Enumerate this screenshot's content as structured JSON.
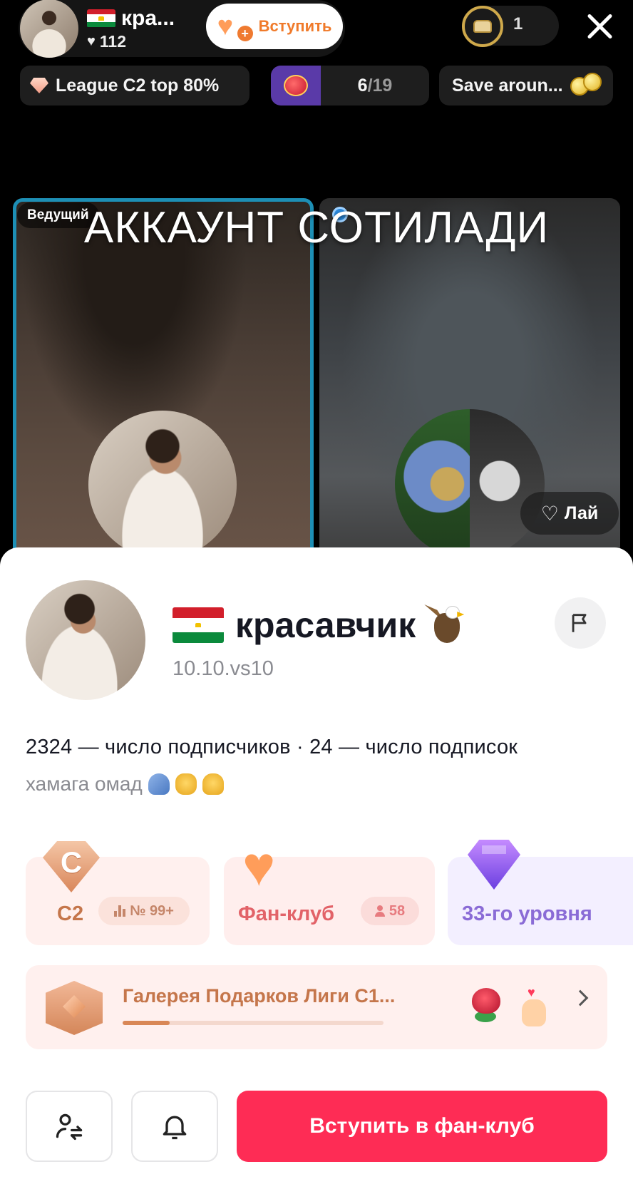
{
  "top_bar": {
    "host_name": "кра...",
    "host_likes": "112",
    "join_button_label": "Вступить",
    "viewer_count": "1"
  },
  "chips": {
    "league": "League C2 top 80%",
    "match_current": "6",
    "match_total": "/19",
    "save": "Save aroun..."
  },
  "stream": {
    "host_tag": "Ведущий",
    "overlay_title": "АККАУНТ СОТИЛАДИ",
    "like_label": "Лай"
  },
  "profile": {
    "name": "красавчик",
    "handle": "10.10.vs10",
    "stats": "2324 — число подписчиков · 24 — число подписок",
    "bio": "хамага омад"
  },
  "cards": {
    "league_letter": "C",
    "league_label": "C2",
    "league_rank": "№ 99+",
    "fan_label": "Фан-клуб",
    "fan_count": "58",
    "level_label": "33-го уровня"
  },
  "gallery": {
    "title": "Галерея Подарков Лиги C1...",
    "progress": 0.18
  },
  "actions": {
    "fan_join_label": "Вступить в фан-клуб"
  },
  "colors": {
    "accent": "#fe2c55",
    "host_border": "#1d8fb5",
    "join_text": "#f07a2a"
  },
  "icons": [
    "heart-icon",
    "sofa-icon",
    "close-icon",
    "diamond-icon",
    "coins-icon",
    "flag-icon",
    "report-icon",
    "add-friend-icon",
    "bell-icon",
    "chevron-right-icon"
  ]
}
